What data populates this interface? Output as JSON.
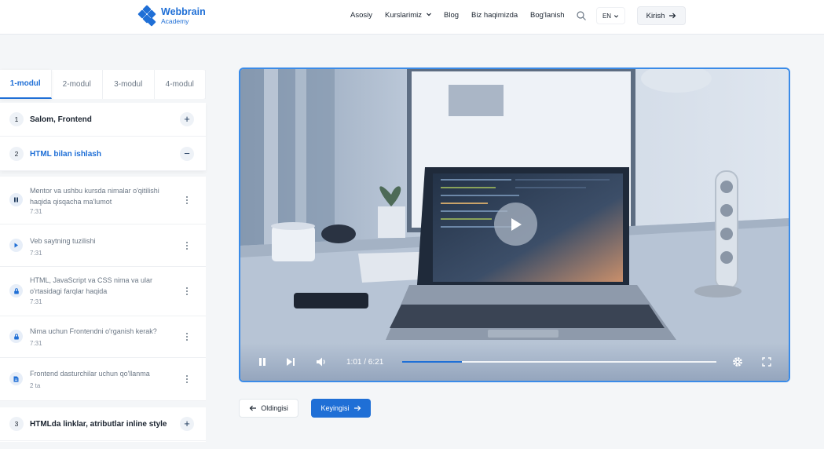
{
  "brand": {
    "name": "Webbrain",
    "sub": "Academy",
    "color": "#1f6fd6"
  },
  "nav": {
    "items": [
      "Asosiy",
      "Kurslarimiz",
      "Blog",
      "Biz haqimizda",
      "Bog'lanish"
    ],
    "lang": "EN",
    "login": "Kirish"
  },
  "tabs": [
    "1-modul",
    "2-modul",
    "3-modul",
    "4-modul"
  ],
  "active_tab": "1-modul",
  "sections": [
    {
      "num": "1",
      "title": "Salom, Frontend",
      "state": "collapsed"
    },
    {
      "num": "2",
      "title": "HTML bilan ishlash",
      "state": "expanded"
    },
    {
      "num": "3",
      "title": "HTMLda linklar, atributlar inline style",
      "state": "collapsed"
    }
  ],
  "lessons": [
    {
      "title": "Mentor va ushbu kursda nimalar o'qitilishi haqida qisqacha ma'lumot",
      "meta": "7:31",
      "icon": "pause-icon"
    },
    {
      "title": "Veb saytning tuzilishi",
      "meta": "7:31",
      "icon": "play-icon"
    },
    {
      "title": "HTML, JavaScript va CSS nima va ular o'rtasidagi farqlar haqida",
      "meta": "7:31",
      "icon": "lock-icon"
    },
    {
      "title": "Nima uchun Frontendni o'rganish kerak?",
      "meta": "7:31",
      "icon": "lock-icon"
    },
    {
      "title": "Frontend dasturchilar uchun qo'llanma",
      "meta": "2 ta",
      "icon": "document-icon"
    }
  ],
  "player": {
    "time": "1:01 / 6:21",
    "progress": 0.19
  },
  "buttons": {
    "prev": "Oldingisi",
    "next": "Keyingisi"
  }
}
